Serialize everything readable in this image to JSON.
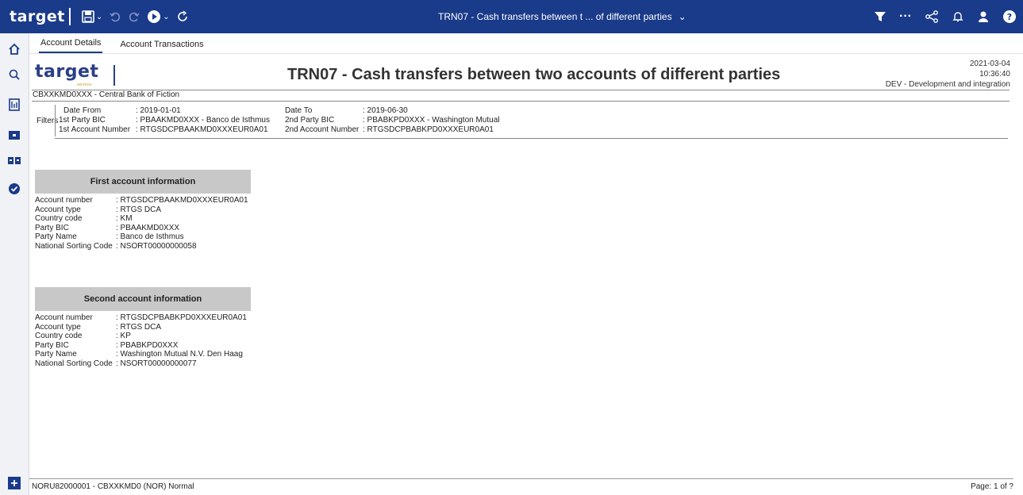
{
  "app": {
    "logo": "target",
    "window_title": "TRN07 - Cash transfers between t ... of different parties"
  },
  "icons": {
    "save": "save-icon",
    "undo": "undo-icon",
    "redo": "redo-icon",
    "run": "play-icon",
    "refresh": "refresh-icon",
    "filter": "filter-icon",
    "more": "more-icon",
    "share": "share-icon",
    "notifications": "bell-icon",
    "user": "user-icon",
    "help": "help-icon"
  },
  "colors": {
    "topbar": "#1a3a8a",
    "accent": "#2b3f86",
    "section_header": "#c8c8c8"
  },
  "tabs": [
    {
      "label": "Account Details"
    },
    {
      "label": "Account Transactions"
    }
  ],
  "report": {
    "logo": "target",
    "logo_sub": "services",
    "title": "TRN07 - Cash transfers between two accounts of different parties",
    "date": "2021-03-04",
    "time": "10:36:40",
    "environment": "DEV - Development and integration",
    "central_bank": "CBXXKMD0XXX - Central Bank of Fiction",
    "filters": {
      "label": "Filters",
      "date_from_label": "Date From",
      "date_from_value": ": 2019-01-01",
      "date_to_label": "Date To",
      "date_to_value": ": 2019-06-30",
      "party1_bic_label": "1st Party BIC",
      "party1_bic_value": ": PBAAKMD0XXX - Banco de Isthmus",
      "party2_bic_label": "2nd Party BIC",
      "party2_bic_value": ": PBABKPD0XXX - Washington Mutual",
      "account1_label": "1st Account Number",
      "account1_value": ": RTGSDCPBAAKMD0XXXEUR0A01",
      "account2_label": "2nd Account Number",
      "account2_value": ": RTGSDCPBABKPD0XXXEUR0A01"
    },
    "first_account": {
      "heading": "First account information",
      "rows": [
        {
          "k": "Account number",
          "v": ": RTGSDCPBAAKMD0XXXEUR0A01"
        },
        {
          "k": "Account type",
          "v": ": RTGS DCA"
        },
        {
          "k": "Country code",
          "v": ": KM"
        },
        {
          "k": "Party BIC",
          "v": ": PBAAKMD0XXX"
        },
        {
          "k": "Party Name",
          "v": ": Banco de Isthmus"
        },
        {
          "k": "National Sorting Code",
          "v": ": NSORT00000000058"
        }
      ]
    },
    "second_account": {
      "heading": "Second account information",
      "rows": [
        {
          "k": "Account number",
          "v": ": RTGSDCPBABKPD0XXXEUR0A01"
        },
        {
          "k": "Account type",
          "v": ": RTGS DCA"
        },
        {
          "k": "Country code",
          "v": ": KP"
        },
        {
          "k": "Party BIC",
          "v": ": PBABKPD0XXX"
        },
        {
          "k": "Party Name",
          "v": ": Washington Mutual N.V. Den Haag"
        },
        {
          "k": "National Sorting Code",
          "v": ": NSORT00000000077"
        }
      ]
    }
  },
  "footer": {
    "left": "NORU82000001 - CBXXKMD0 (NOR) Normal",
    "right": "Page: 1 of ?"
  }
}
